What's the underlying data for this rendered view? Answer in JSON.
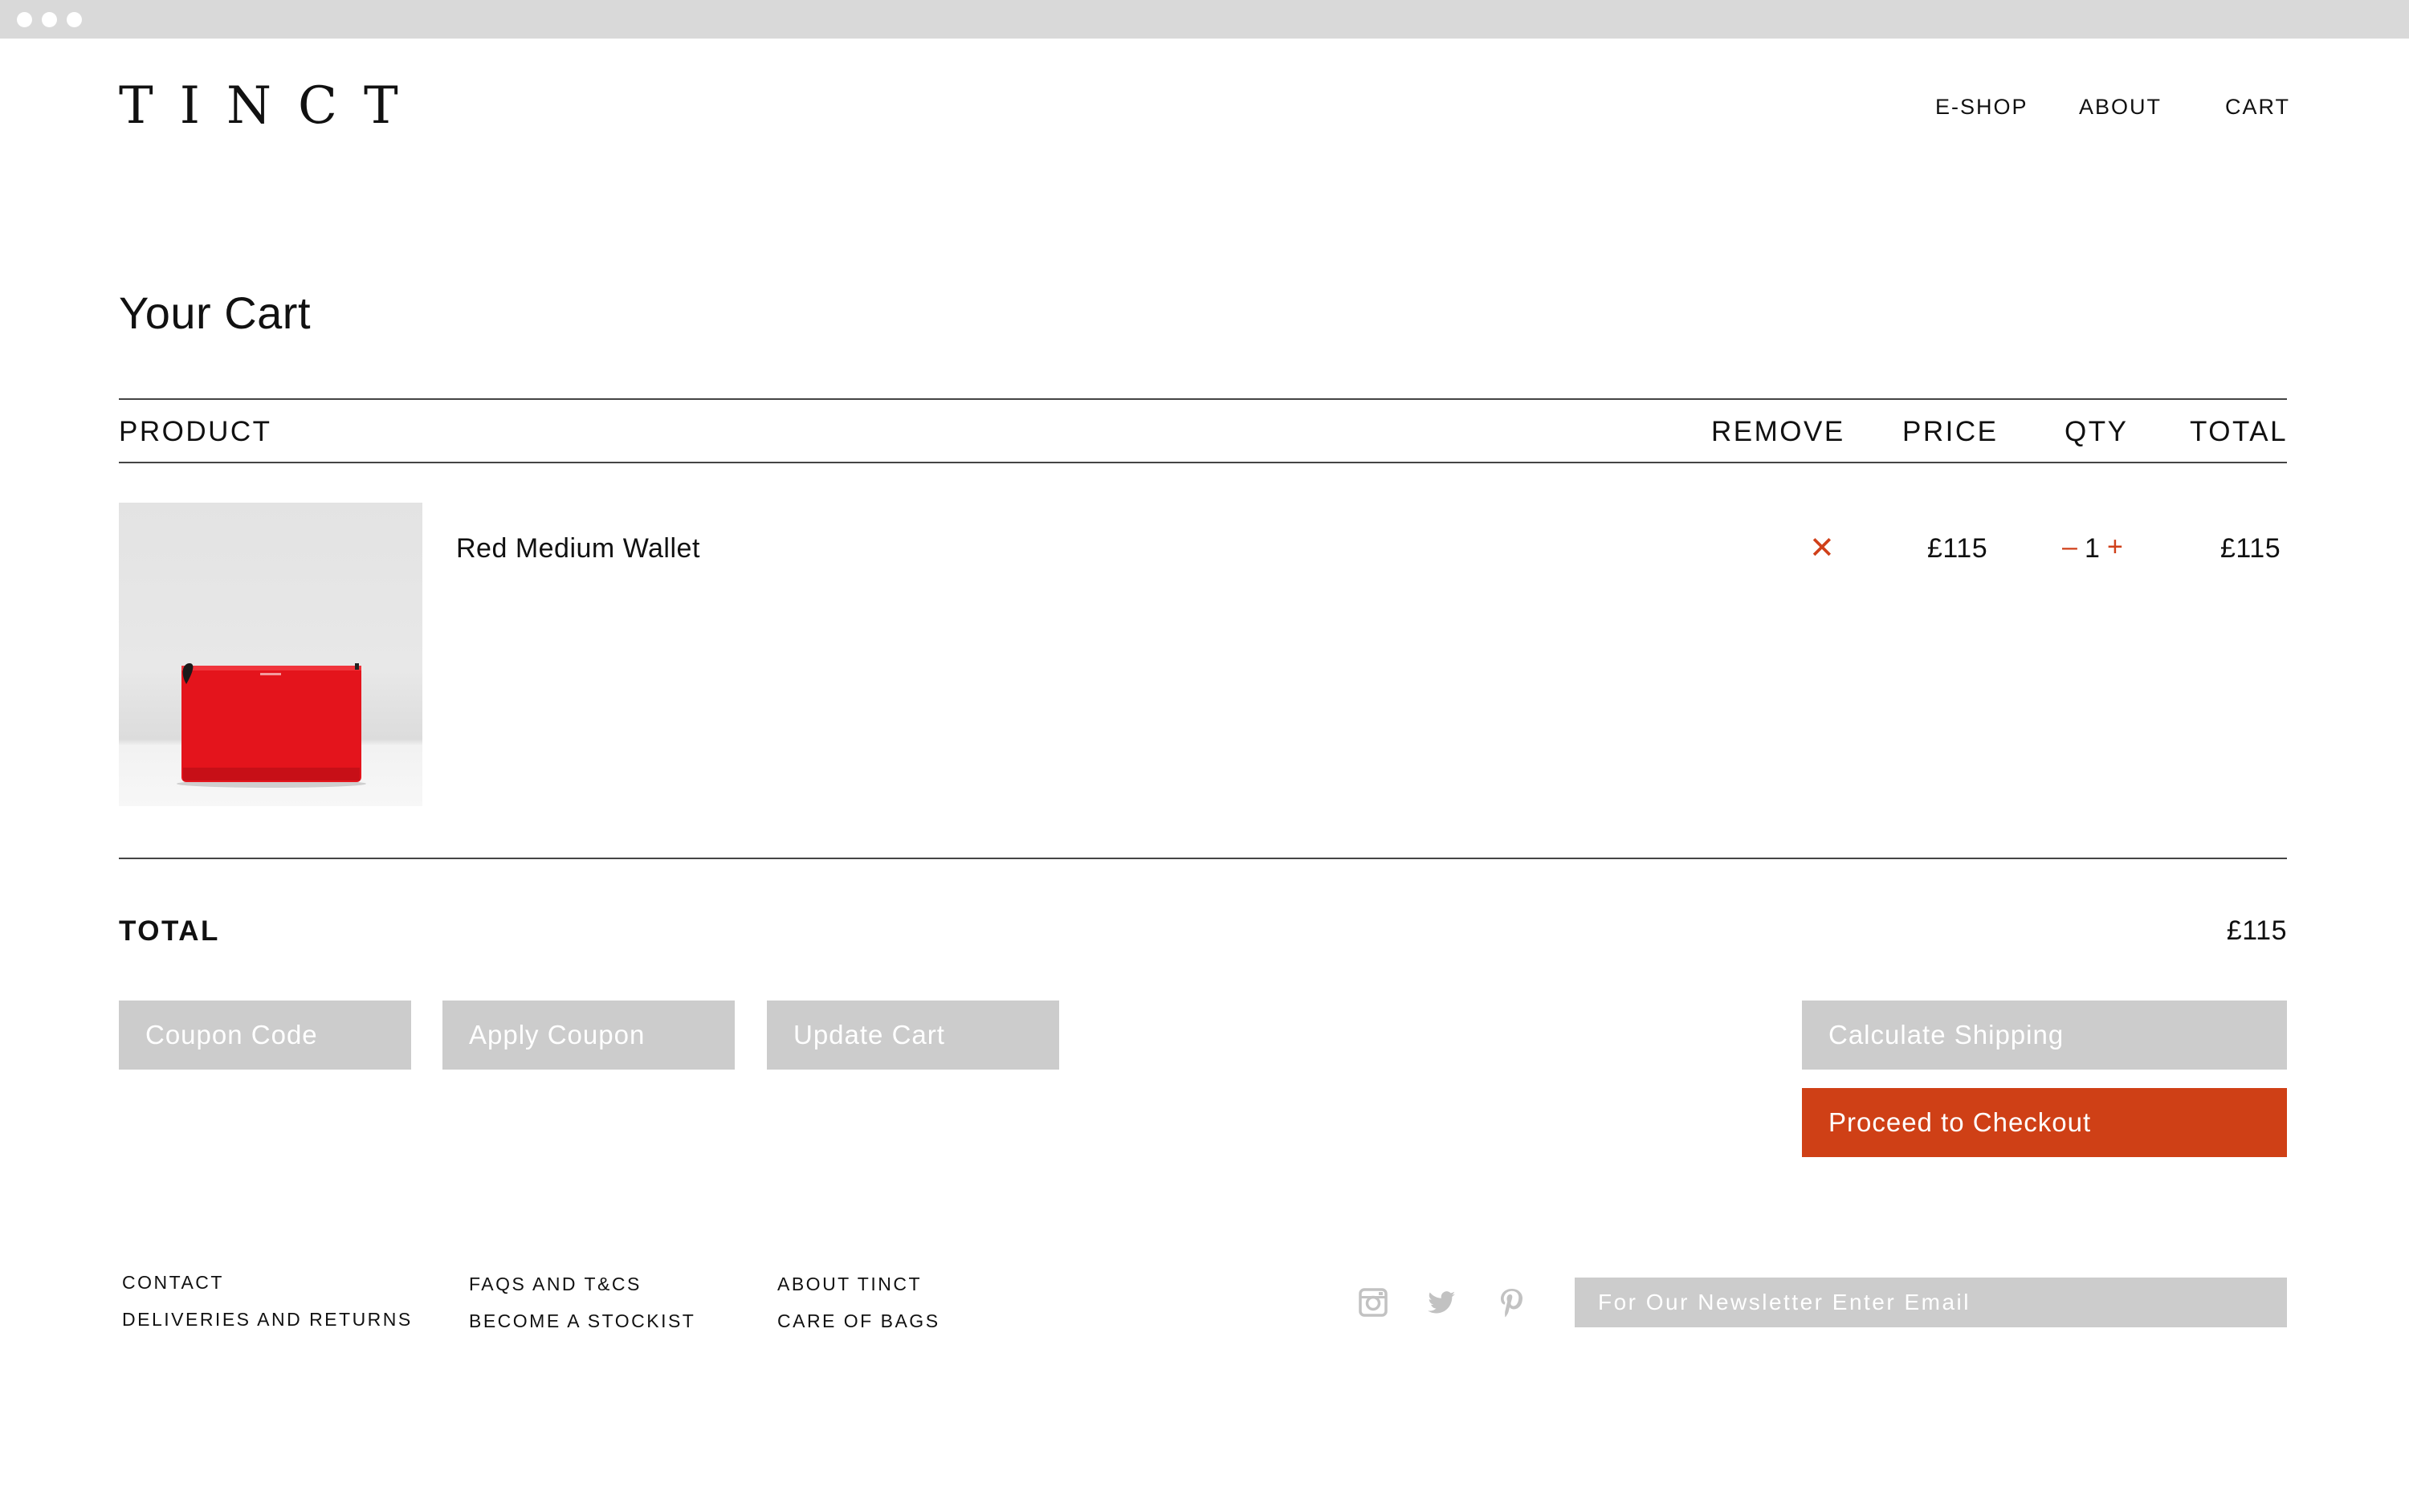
{
  "brand": {
    "logo": "TINCT"
  },
  "nav": {
    "items": [
      {
        "label": "E-SHOP"
      },
      {
        "label": "ABOUT"
      },
      {
        "label": "CART"
      }
    ]
  },
  "cart": {
    "title": "Your Cart",
    "columns": {
      "product": "PRODUCT",
      "remove": "REMOVE",
      "price": "PRICE",
      "qty": "QTY",
      "total": "TOTAL"
    },
    "items": [
      {
        "name": "Red Medium Wallet",
        "image_icon": "red-wallet-image",
        "remove_icon": "close-icon",
        "remove_symbol": "✕",
        "price": "£115",
        "qty": "1",
        "qty_minus": "–",
        "qty_plus": "+",
        "total": "£115"
      }
    ],
    "summary": {
      "label": "TOTAL",
      "value": "£115"
    },
    "actions": {
      "coupon_placeholder": "Coupon Code",
      "apply_coupon": "Apply Coupon",
      "update_cart": "Update Cart",
      "calculate_shipping": "Calculate Shipping",
      "checkout": "Proceed to Checkout"
    }
  },
  "footer": {
    "columns": [
      [
        "CONTACT",
        "DELIVERIES AND RETURNS"
      ],
      [
        "FAQS AND T&CS",
        "BECOME A STOCKIST"
      ],
      [
        "ABOUT TINCT",
        "CARE OF BAGS"
      ]
    ],
    "social": [
      "instagram-icon",
      "twitter-icon",
      "pinterest-icon"
    ],
    "newsletter_placeholder": "For Our Newsletter Enter Email"
  },
  "colors": {
    "accent": "#cf4016",
    "button_grey": "#cccccc",
    "chrome": "#d9d9d9",
    "text": "#111111"
  }
}
